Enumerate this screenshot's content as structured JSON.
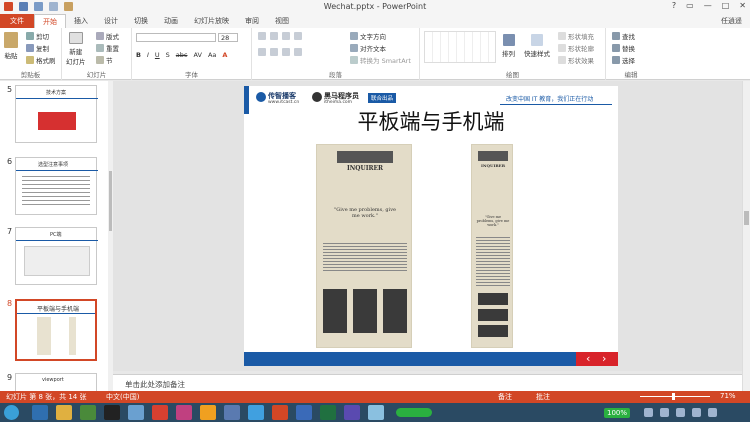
{
  "window": {
    "title": "Wechat.pptx - PowerPoint",
    "user": "任逍遥",
    "controls": [
      "?",
      "▭",
      "—",
      "□",
      "✕"
    ]
  },
  "tabs": [
    "文件",
    "开始",
    "插入",
    "设计",
    "切换",
    "动画",
    "幻灯片放映",
    "审阅",
    "视图"
  ],
  "ribbon": {
    "clipboard": {
      "paste": "粘贴",
      "cut": "剪切",
      "copy": "复制",
      "format_painter": "格式刷",
      "label": "剪贴板"
    },
    "slides": {
      "new_slide": "新建\n幻灯片",
      "layout": "版式",
      "reset": "重置",
      "section": "节",
      "label": "幻灯片"
    },
    "font": {
      "label": "字体",
      "size": "28",
      "buttons": [
        "B",
        "I",
        "U",
        "S",
        "abc",
        "AV",
        "Aa",
        "A"
      ]
    },
    "paragraph": {
      "text_direction": "文字方向",
      "align_text": "对齐文本",
      "smartart": "转换为 SmartArt",
      "label": "段落"
    },
    "drawing": {
      "arrange": "排列",
      "quick_styles": "快速样式",
      "fill": "形状填充",
      "outline": "形状轮廓",
      "effects": "形状效果",
      "label": "绘图"
    },
    "editing": {
      "find": "查找",
      "replace": "替换",
      "select": "选择",
      "label": "编辑"
    }
  },
  "thumbnails": [
    {
      "num": "5",
      "title": "技术方案"
    },
    {
      "num": "6",
      "title": "选型注意事项"
    },
    {
      "num": "7",
      "title": "PC端"
    },
    {
      "num": "8",
      "title": "平板端与手机端",
      "selected": true
    },
    {
      "num": "9",
      "title": "viewport"
    }
  ],
  "slide": {
    "logo1": "传智播客",
    "logo1_url": "www.itcast.cn",
    "logo2": "黑马程序员",
    "logo2_url": "itheima.com",
    "badge": "联合出品",
    "slogan": "改变中国 IT 教育，我们正在行动",
    "title": "平板端与手机端",
    "mock_masthead": "INQUIRER",
    "mock_quote": "\"Give me problems, give me work.\"",
    "mock_quote_small": "\"Give me problems, give me work.\"",
    "nav_prev": "‹",
    "nav_next": "›"
  },
  "notes_placeholder": "单击此处添加备注",
  "status": {
    "slide_info": "幻灯片 第 8 张，共 14 张",
    "language": "中文(中国)",
    "notes": "备注",
    "comments": "批注",
    "zoom": "71%"
  },
  "taskbar": {
    "zoom_badge": "100%"
  }
}
